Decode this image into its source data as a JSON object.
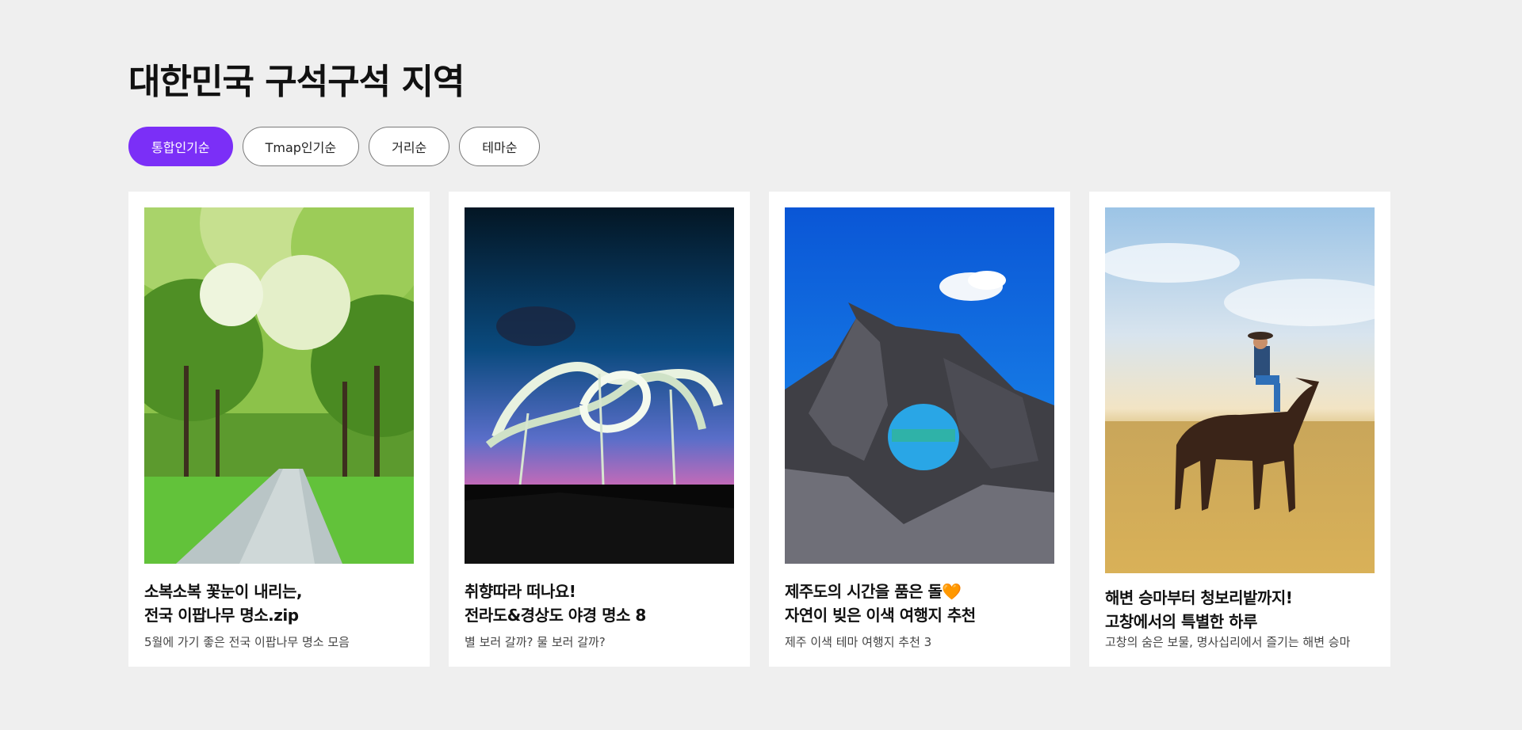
{
  "section": {
    "title": "대한민국 구석구석 지역"
  },
  "filters": [
    {
      "label": "통합인기순",
      "active": true
    },
    {
      "label": "Tmap인기순",
      "active": false
    },
    {
      "label": "거리순",
      "active": false
    },
    {
      "label": "테마순",
      "active": false
    }
  ],
  "cards": [
    {
      "title_line1": "소복소복 꽃눈이 내리는,",
      "title_line2": "전국 이팝나무 명소.zip",
      "description": "5월에 가기 좋은 전국 이팝나무 명소 모음",
      "image": "tree-lined-path"
    },
    {
      "title_line1": "취향따라 떠나요!",
      "title_line2": "전라도&경상도 야경 명소 8",
      "description": "별 보러 갈까? 물 보러 갈까?",
      "image": "roller-coaster-night"
    },
    {
      "title_line1": "제주도의 시간을 품은 돌🧡",
      "title_line2": "자연이 빚은 이색 여행지 추천",
      "description": "제주 이색 테마 여행지 추천 3",
      "image": "volcanic-rock-arch"
    },
    {
      "title_line1": "해변 승마부터 청보리밭까지!",
      "title_line2": "고창에서의 특별한 하루",
      "description": "고창의 숨은 보물, 명사십리에서 즐기는 해변 승마",
      "image": "horse-on-beach"
    }
  ],
  "colors": {
    "background": "#efefef",
    "accent": "#7b2ff7"
  }
}
